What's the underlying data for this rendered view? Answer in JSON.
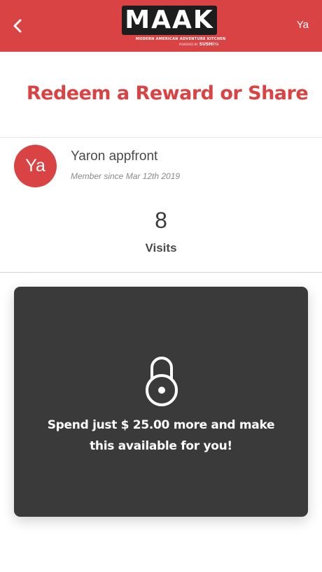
{
  "header": {
    "logo_text": "MAAK",
    "logo_tagline": "MODERN AMERICAN ADVENTURE KITCHEN",
    "logo_powered": "POWERED BY",
    "logo_brand": "SUSHI",
    "logo_brand_suffix": "Ya",
    "user_initials": "Ya",
    "background_color": "#d94343"
  },
  "page": {
    "title": "Redeem a Reward or Share",
    "accent_color": "#d94343"
  },
  "user": {
    "initials": "Ya",
    "name": "Yaron appfront",
    "member_since": "Member since Mar 12th 2019"
  },
  "visits": {
    "count": "8",
    "label": "Visits"
  },
  "reward": {
    "message_line1": "Spend just $ 25.00 more and make",
    "message_line2": "this available for you!",
    "icon": "lock-icon",
    "card_color": "#3a3a3a"
  },
  "icons": {
    "back": "chevron-left-icon"
  }
}
